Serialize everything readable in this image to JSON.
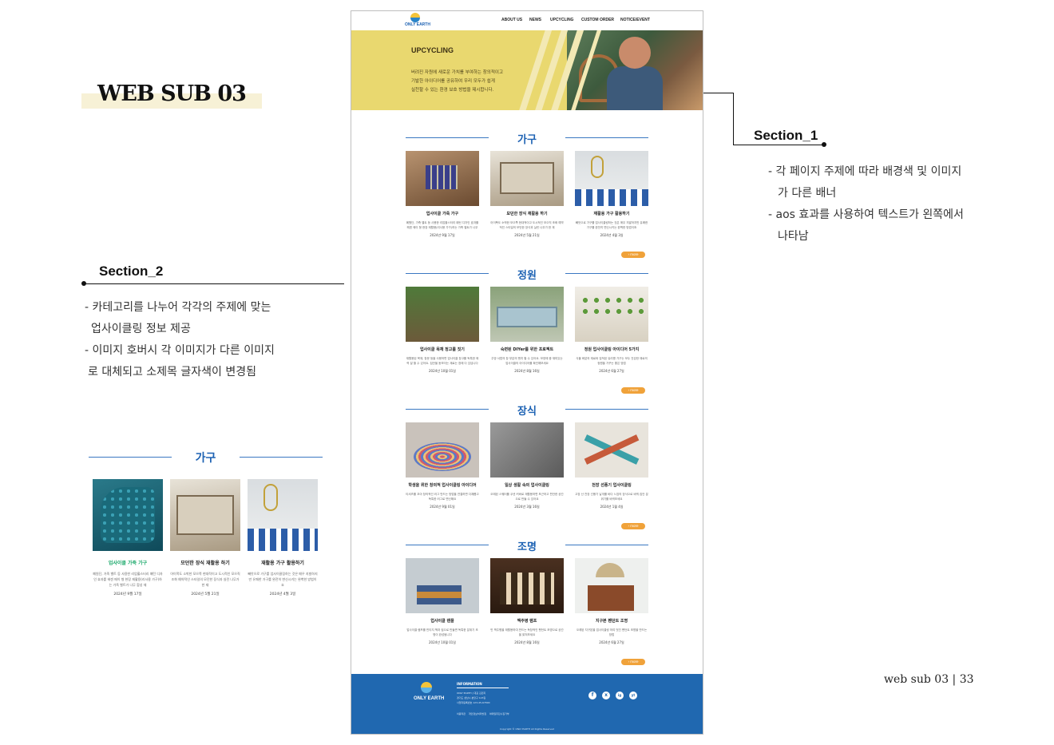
{
  "page_title": "WEB SUB 03",
  "section1": {
    "title": "Section_1",
    "notes": [
      "- 각 페이지 주제에 따라 배경색 및 이미지",
      "가 다른 배너",
      "- aos 효과를 사용하여 텍스트가 왼쪽에서",
      "나타남"
    ]
  },
  "section2": {
    "title": "Section_2",
    "notes": [
      "- 카테고리를 나누어 각각의 주제에 맞는",
      "업사이클링 정보 제공",
      "- 이미지 호버시 각 이미지가 다른 이미지",
      "로  대체되고 소제목 글자색이 변경됨"
    ]
  },
  "mock": {
    "nav": {
      "logo": "ONLY EARTH",
      "menu": [
        "ABOUT US",
        "NEWS",
        "UPCYCLING",
        "CUSTOM ORDER",
        "NOTICE/EVENT"
      ]
    },
    "banner": {
      "title": "UPCYCLING",
      "desc": [
        "버려진 자원에 새로운 가치를 부여하는 창의적이고",
        "기발한 아이디어를 공유하여 우리 모두가 쉽게",
        "실천할 수 있는 환경 보호 방법을 제시합니다."
      ]
    },
    "more_label": "more",
    "categories": [
      {
        "title": "가구",
        "cards": [
          {
            "title": "업사이클 가죽 가구",
            "desc": "폐원단, 가죽 벨트 등 사용한 리업홀스터리 패턴 디자인 효과를 헤겐 메이 형 현장 재활용(리사용 가구)하는 가죽 벨트가 나무 합성 재",
            "date": "2024년 9월 17일"
          },
          {
            "title": "모던한 장식 재활용 하기",
            "desc": "아이폭도 소박한 모으쪽 현대적이고 도시적인 모으직 조화 예약적인 스타일의 모던한 장식과 실린 나무가 한 재",
            "date": "2024년 5월 21일"
          },
          {
            "title": "재활용 가구 활용하기",
            "desc": "빼앗으로 가구를 업사이클링하는 것은 매우 지발하지만 유쾌한 가구를 완전히 변신시키는 완벽한 방법이죠",
            "date": "2024년 4월 3일"
          }
        ]
      },
      {
        "title": "정원",
        "cards": [
          {
            "title": "업사이클 목재 정고를 짓기",
            "desc": "재활용된 목재, 창문 등을 사용하면 업사이클 창고를 독특한 매력 잘 할 수 있어요. 집안을 돋보이는 재료는 창에 다 있답니다",
            "date": "2024년 10월 01일"
          },
          {
            "title": "숙련된 DIYer를 위한 프로젝트",
            "desc": "주방 서랍의 창 부분의 벤치 할 수 있어요. 모양에 중 재미있는 업사이클의 아이디어를 확인해보세요",
            "date": "2024년 8월 16일"
          },
          {
            "title": "정원 업사이클링 아이디어 5가지",
            "desc": "식물 화분의 재료와 집적된 유리병 가구는 모두 건강한 재료의 정원을 가꾸는 좋은 방법",
            "date": "2024년 6월 27일"
          }
        ]
      },
      {
        "title": "장식",
        "cards": [
          {
            "title": "학생을 위한 창의적 업사이클링 아이디어",
            "desc": "티셔츠를 꼬아 창의적인 러그 만드는 방법을 연결하면 다채롭고 독특한 러그로 변신해요",
            "date": "2024년 9월 01일"
          },
          {
            "title": "일상 생활 속의 업사이클링",
            "desc": "오래된 스웨터를 쿠션 커버로 재활용하면 포근하고 편안한 공간으로 만들 수 있어요",
            "date": "2024년 3월 16일"
          },
          {
            "title": "천장 선풍기 업사이클링",
            "desc": "고장 난 천장 선풍기 날개를 바다 느낌의 장식으로 바꿔 집안 분위기를 바꿔보세요",
            "date": "2024년 1월 4일"
          }
        ]
      },
      {
        "title": "조명",
        "cards": [
          {
            "title": "업사이클 랜플",
            "desc": "업사이클 램프를 빈티지 책과 컵으로 만들면 독특한 분위기 조명이 완성됩니다",
            "date": "2024년 10월 01일"
          },
          {
            "title": "맥주병 램프",
            "desc": "빈 맥주병을 재활용하여 만드는 독창적인 펜던트 조명으로 공간을 밝혀보세요",
            "date": "2024년 8월 16일"
          },
          {
            "title": "지구본 펜던트 조명",
            "desc": "오래된 지구본을 업사이클링 하여 멋진 펜던트 조명을 만드는 방법",
            "date": "2024년 6월 27일"
          }
        ]
      }
    ],
    "footer": {
      "logo": "ONLY EARTH",
      "info_title": "INFORMATION",
      "info_lines": [
        "ONLY EARTH  |  대표 김민지",
        "경기도 성남시 분당구 123길",
        "사업자등록번호 123-45-67890"
      ],
      "links": [
        "이용약관",
        "개인정보처리방침",
        "이메일무단수집거부"
      ],
      "social": [
        "f",
        "x",
        "ig",
        "yt"
      ],
      "copyright": "Copyright © ONLY EARTH All Rights Reserved"
    }
  },
  "preview": {
    "title": "가구",
    "cards": [
      {
        "title": "업사이클 가죽 가구",
        "desc": "폐원단, 가죽 벨트 등 사용한 리업홀스터리 패턴 디자인 효과를 헤겐 메이 형 현장 재활용(리사용 가구)하는 가죽 벨트가 나무 합성 재",
        "date": "2024년 9월 17일"
      },
      {
        "title": "모던한 장식 재활용 하기",
        "desc": "아이폭도 소박한 모으쪽 현대적이고 도시적인 모으직 조화 예약적인 스타일의 모던한 장식과 실린 나무가 한 재",
        "date": "2024년 5월 21일"
      },
      {
        "title": "재활용 가구 활용하기",
        "desc": "빼앗으로 가구를 업사이클링하는 것은 매우 지발하지만 유쾌한 가구를 완전히 변신시키는 완벽한 방법이죠",
        "date": "2024년 4월 3일"
      }
    ],
    "active_title_color": "#1aa86a"
  },
  "page_footer": "web sub 03  |  33",
  "colors": {
    "accent_blue": "#1d62b3",
    "banner_yellow": "#e9d86f",
    "more_orange": "#f0a23a",
    "footer_blue": "#2068b0"
  }
}
